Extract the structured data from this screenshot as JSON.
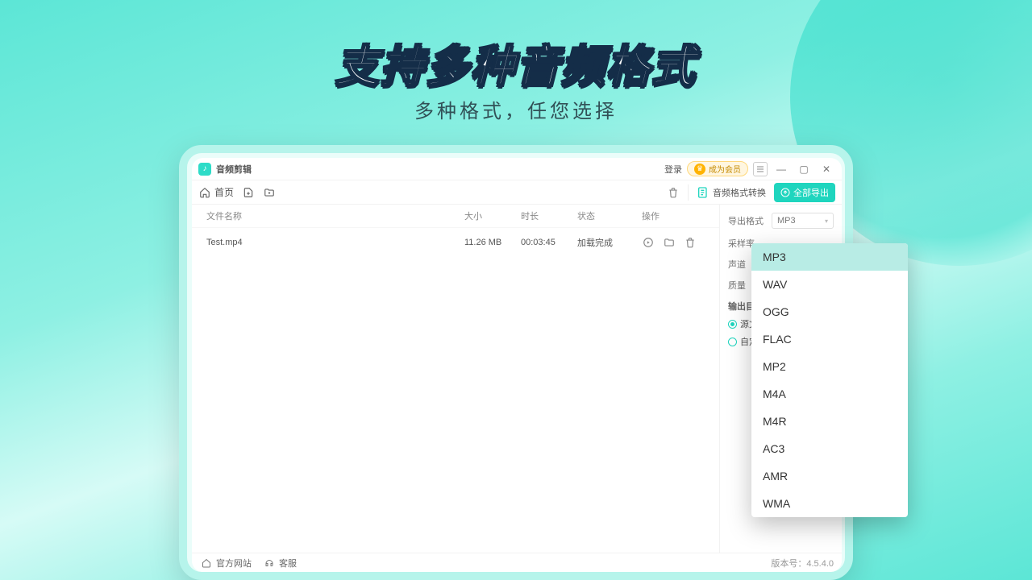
{
  "hero": {
    "title": "支持多种音频格式",
    "subtitle": "多种格式，任您选择"
  },
  "titlebar": {
    "app_name": "音频剪辑",
    "login": "登录",
    "vip": "成为会员"
  },
  "toolbar": {
    "home": "首页",
    "delete_tooltip": "删除",
    "feature": "音频格式转换",
    "export_all": "全部导出"
  },
  "table": {
    "headers": {
      "name": "文件名称",
      "size": "大小",
      "duration": "时长",
      "status": "状态",
      "ops": "操作"
    },
    "rows": [
      {
        "name": "Test.mp4",
        "size": "11.26 MB",
        "duration": "00:03:45",
        "status": "加载完成"
      }
    ]
  },
  "side": {
    "export_format_label": "导出格式",
    "export_format_value": "MP3",
    "sample_rate_label": "采样率",
    "channel_label": "声道",
    "quality_label": "质量",
    "output_dir_label": "输出目录",
    "radio_source": "源文",
    "radio_custom": "自定"
  },
  "dropdown": {
    "options": [
      "MP3",
      "WAV",
      "OGG",
      "FLAC",
      "MP2",
      "M4A",
      "M4R",
      "AC3",
      "AMR",
      "WMA"
    ],
    "selected": "MP3"
  },
  "footer": {
    "official": "官方网站",
    "support": "客服",
    "version_label": "版本号：",
    "version": "4.5.4.0"
  }
}
